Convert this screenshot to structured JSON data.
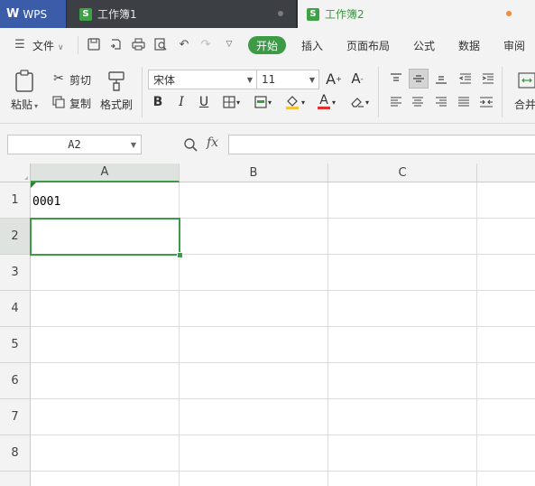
{
  "tabs": {
    "app_label": "WPS",
    "book1_label": "工作簿1",
    "book2_label": "工作簿2"
  },
  "menu": {
    "file_label": "文件",
    "start_label": "开始",
    "insert_label": "插入",
    "page_layout_label": "页面布局",
    "formula_label": "公式",
    "data_label": "数据",
    "review_label": "审阅"
  },
  "ribbon": {
    "paste_label": "粘贴",
    "cut_label": "剪切",
    "copy_label": "复制",
    "format_painter_label": "格式刷",
    "font_name": "宋体",
    "font_size": "11",
    "merge_label": "合并"
  },
  "formula_bar": {
    "name_box_value": "A2",
    "fx_label": "fx",
    "formula_value": ""
  },
  "grid": {
    "columns": [
      "A",
      "B",
      "C"
    ],
    "rows": [
      "1",
      "2",
      "3",
      "4",
      "5",
      "6",
      "7",
      "8"
    ],
    "cells": {
      "A1": "0001"
    }
  },
  "colors": {
    "accent_green": "#3d9a46",
    "wps_tab_blue": "#3b5ca8",
    "dark_tabbar": "#2b2d30"
  }
}
